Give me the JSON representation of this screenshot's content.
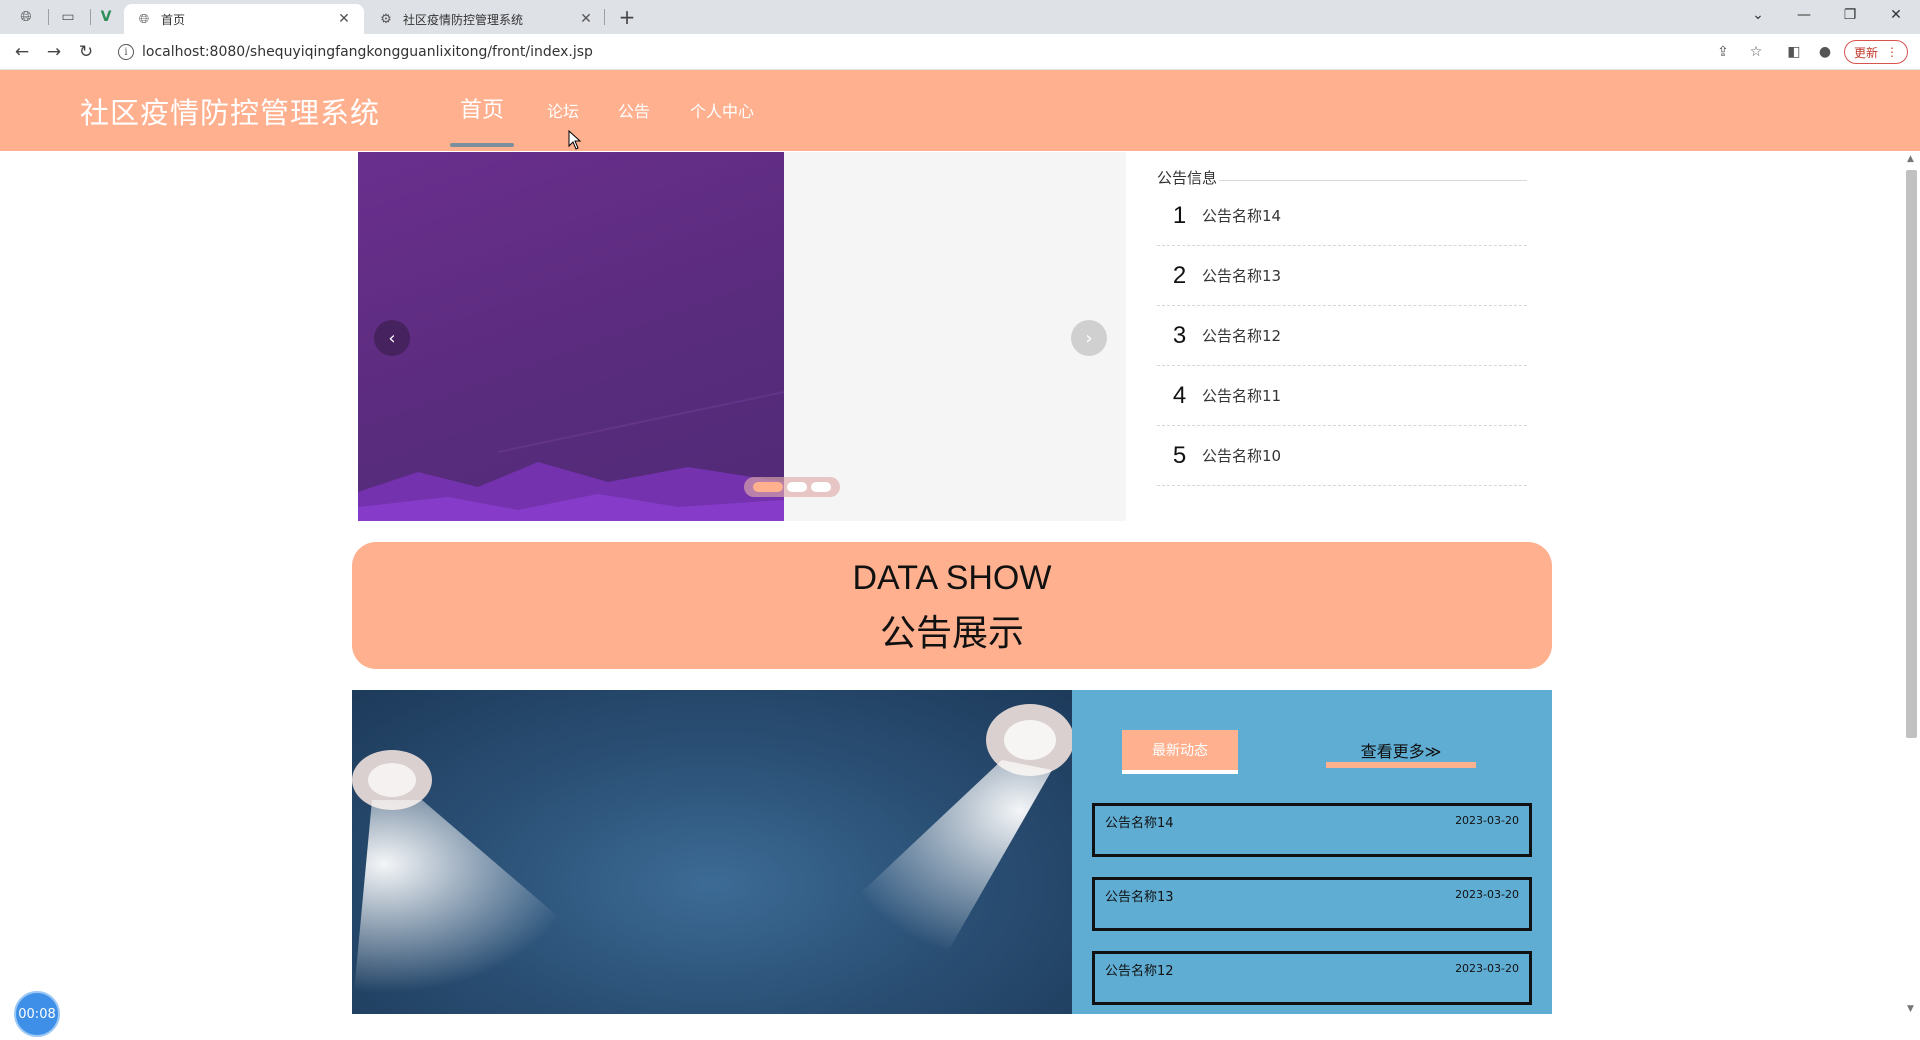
{
  "browser": {
    "tabs": [
      {
        "title": "首页",
        "icon": "globe-icon",
        "active": true
      },
      {
        "title": "社区疫情防控管理系统",
        "icon": "settings-globe-icon",
        "active": false
      }
    ],
    "url": "localhost:8080/shequyiqingfangkongguanlixitong/front/index.jsp",
    "update_label": "更新"
  },
  "site": {
    "title": "社区疫情防控管理系统",
    "nav": [
      {
        "label": "首页",
        "active": true
      },
      {
        "label": "论坛",
        "active": false
      },
      {
        "label": "公告",
        "active": false
      },
      {
        "label": "个人中心",
        "active": false
      }
    ]
  },
  "carousel": {
    "slide_count": 3,
    "active_index": 0
  },
  "notice": {
    "heading": "公告信息",
    "items": [
      {
        "num": "1",
        "name": "公告名称14"
      },
      {
        "num": "2",
        "name": "公告名称13"
      },
      {
        "num": "3",
        "name": "公告名称12"
      },
      {
        "num": "4",
        "name": "公告名称11"
      },
      {
        "num": "5",
        "name": "公告名称10"
      }
    ]
  },
  "data_show": {
    "title_en": "DATA SHOW",
    "title_zh": "公告展示"
  },
  "news": {
    "tab_label": "最新动态",
    "more_label": "查看更多≫",
    "items": [
      {
        "title": "公告名称14",
        "date": "2023-03-20"
      },
      {
        "title": "公告名称13",
        "date": "2023-03-20"
      },
      {
        "title": "公告名称12",
        "date": "2023-03-20"
      }
    ]
  },
  "timer": "00:08",
  "colors": {
    "accent": "#ffb08f",
    "panel": "#60add4",
    "carousel_slide": "#5e2d82"
  }
}
